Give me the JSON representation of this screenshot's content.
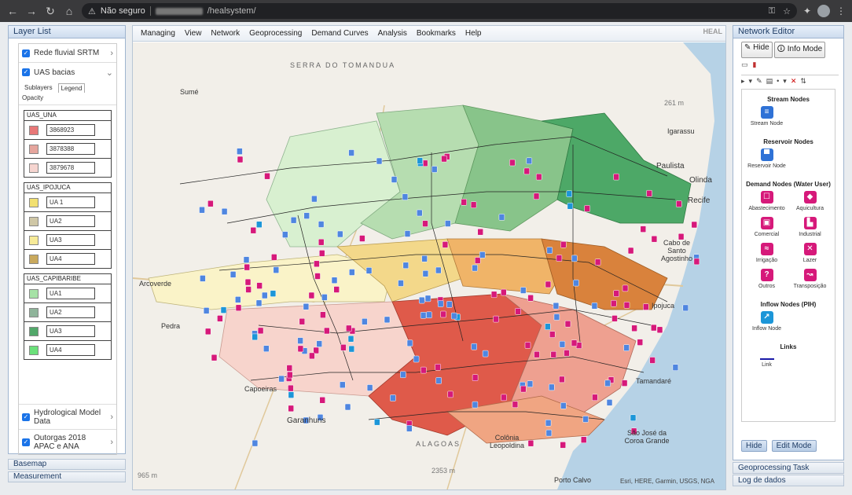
{
  "browser": {
    "security_label": "Não seguro",
    "url_path": "/healsystem/"
  },
  "left_panel": {
    "title": "Layer List",
    "layers": [
      {
        "label": "Rede fluvial SRTM",
        "checked": true
      },
      {
        "label": "UAS bacias",
        "checked": true
      }
    ],
    "tabs": [
      "Sublayers",
      "Legend"
    ],
    "active_tab": "Legend",
    "opacity_label": "Opacity",
    "groups": [
      {
        "title": "UAS_UNA",
        "items": [
          {
            "label": "3868923",
            "color": "#e87878"
          },
          {
            "label": "3878388",
            "color": "#e5a59d"
          },
          {
            "label": "3879678",
            "color": "#f6d5d0"
          }
        ]
      },
      {
        "title": "UAS_IPOJUCA",
        "items": [
          {
            "label": "UA 1",
            "color": "#f2e070"
          },
          {
            "label": "UA2",
            "color": "#cfc7a6"
          },
          {
            "label": "UA3",
            "color": "#f6ea98"
          },
          {
            "label": "UA4",
            "color": "#c9a95d"
          }
        ]
      },
      {
        "title": "UAS_CAPIBARIBE",
        "items": [
          {
            "label": "UA1",
            "color": "#a6e2a6"
          },
          {
            "label": "UA2",
            "color": "#8fb49a"
          },
          {
            "label": "UA3",
            "color": "#52a86a"
          },
          {
            "label": "UA4",
            "color": "#6be07a"
          }
        ]
      }
    ],
    "bottom_layers": [
      {
        "label": "Hydrological Model Data",
        "checked": true
      },
      {
        "label": "Outorgas 2018 APAC e ANA",
        "checked": true
      }
    ],
    "accordions": [
      "Basemap",
      "Measurement"
    ]
  },
  "menu": {
    "items": [
      "Managing",
      "View",
      "Network",
      "Geoprocessing",
      "Demand Curves",
      "Analysis",
      "Bookmarks",
      "Help"
    ],
    "brand": "HEAL"
  },
  "map": {
    "labels": {
      "serra": "SERRA DO TOMANDUA",
      "sume": "Sumé",
      "igarassu": "Igarassu",
      "paulista": "Paulista",
      "olinda": "Olinda",
      "recife": "Recife",
      "arcoverde": "Arcoverde",
      "pedra": "Pedra",
      "cabo": "Cabo de Santo Agostinho",
      "tamandare": "Tamandaré",
      "garanhuns": "Garanhuns",
      "colonia": "Colônia Leopoldina",
      "sao_jose": "São José da Coroa Grande",
      "porto_calvo": "Porto Calvo",
      "alagoas": "ALAGOAS",
      "elev1": "965 m",
      "elev2": "2353 m",
      "elev3": "261 m",
      "capoeiras": "Capoeiras",
      "ipojuca": "Ipojuca"
    },
    "attribution": "Esri, HERE, Garmin, USGS, NGA"
  },
  "right_panel": {
    "title": "Network Editor",
    "hide_label": "Hide",
    "info_mode_label": "Info Mode",
    "sections": [
      {
        "title": "Stream Nodes",
        "nodes": [
          {
            "label": "Stream Node",
            "icon": "stream-node-icon",
            "kind": "blue",
            "glyph": "≡"
          }
        ]
      },
      {
        "title": "Reservoir Nodes",
        "nodes": [
          {
            "label": "Reservoir Node",
            "icon": "reservoir-node-icon",
            "kind": "blue",
            "glyph": "▀"
          }
        ]
      },
      {
        "title": "Demand Nodes (Water User)",
        "nodes": [
          {
            "label": "Abastecimento",
            "icon": "supply-icon",
            "kind": "pink",
            "glyph": "☐"
          },
          {
            "label": "Aquicultura",
            "icon": "aquaculture-icon",
            "kind": "pink",
            "glyph": "◆"
          },
          {
            "label": "Comercial",
            "icon": "commercial-icon",
            "kind": "pink",
            "glyph": "▣"
          },
          {
            "label": "Industrial",
            "icon": "industrial-icon",
            "kind": "pink",
            "glyph": "▙"
          },
          {
            "label": "Irrigação",
            "icon": "irrigation-icon",
            "kind": "pink",
            "glyph": "≈"
          },
          {
            "label": "Lazer",
            "icon": "leisure-icon",
            "kind": "pink",
            "glyph": "✕"
          },
          {
            "label": "Outros",
            "icon": "others-icon",
            "kind": "pink",
            "glyph": "?"
          },
          {
            "label": "Transposição",
            "icon": "transposition-icon",
            "kind": "pink",
            "glyph": "↝"
          }
        ]
      },
      {
        "title": "Inflow Nodes (PIH)",
        "nodes": [
          {
            "label": "Inflow Node",
            "icon": "inflow-node-icon",
            "kind": "cyan",
            "glyph": "↗"
          }
        ]
      },
      {
        "title": "Links",
        "nodes": [
          {
            "label": "Link",
            "icon": "link-icon",
            "kind": "line",
            "glyph": ""
          }
        ]
      }
    ],
    "bottom_hide": "Hide",
    "edit_mode": "Edit Mode",
    "accordions": [
      "Geoprocessing Task",
      "Log de dados"
    ]
  }
}
